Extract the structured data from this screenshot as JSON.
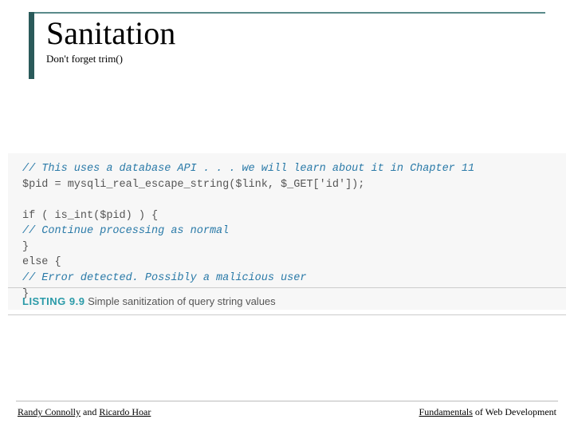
{
  "header": {
    "title": "Sanitation",
    "subtitle": "Don't forget trim()"
  },
  "code": {
    "line1_comment": "// This uses a database API . . . we will learn about it in Chapter 11",
    "line2": "$pid = mysqli_real_escape_string($link, $_GET['id']);",
    "line3": "",
    "line4": "if ( is_int($pid) ) {",
    "line5_comment": "// Continue processing as normal",
    "line6": "}",
    "line7": "else {",
    "line8_comment": "// Error detected. Possibly a malicious user",
    "line9": "}"
  },
  "listing": {
    "label": "LISTING 9.9",
    "caption": "Simple sanitization of query string values"
  },
  "footer": {
    "author1": "Randy Connolly",
    "and": " and ",
    "author2": "Ricardo Hoar",
    "book1": "Fundamentals",
    "book_rest": " of Web Development"
  }
}
